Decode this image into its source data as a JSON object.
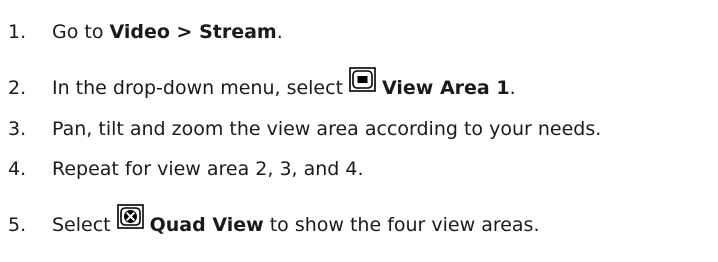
{
  "steps": [
    {
      "number": "1.",
      "pre": "Go to ",
      "bold": "Video > Stream",
      "post": "."
    },
    {
      "number": "2.",
      "pre": "In the drop-down menu, select",
      "icon": "view-area-icon",
      "bold": "View Area 1",
      "post": "."
    },
    {
      "number": "3.",
      "pre": "Pan, tilt and zoom the view area according to your needs."
    },
    {
      "number": "4.",
      "pre": "Repeat for view area 2, 3, and 4."
    },
    {
      "number": "5.",
      "pre": "Select",
      "icon": "quad-view-icon",
      "bold": "Quad View",
      "post": " to show the four view areas."
    }
  ]
}
